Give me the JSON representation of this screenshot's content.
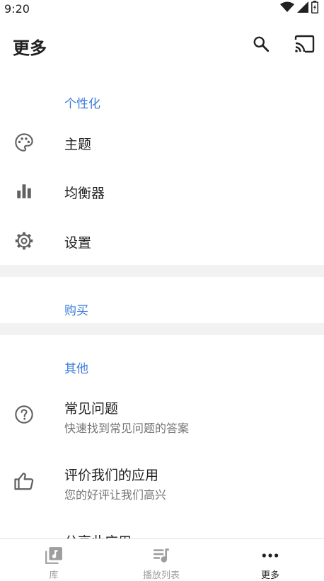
{
  "status_bar": {
    "time": "9:20",
    "icons": [
      "wifi-icon",
      "signal-icon",
      "battery-icon"
    ]
  },
  "app_bar": {
    "title": "更多",
    "actions": [
      "search-icon",
      "cast-icon"
    ]
  },
  "sections": {
    "personalize": {
      "header": "个性化",
      "items": [
        {
          "label": "主题",
          "icon": "palette-icon"
        },
        {
          "label": "均衡器",
          "icon": "equalizer-icon"
        },
        {
          "label": "设置",
          "icon": "gear-icon"
        }
      ]
    },
    "purchase": {
      "header": "购买"
    },
    "other": {
      "header": "其他",
      "items": [
        {
          "label": "常见问题",
          "subtitle": "快速找到常见问题的答案",
          "icon": "help-circle-icon"
        },
        {
          "label": "评价我们的应用",
          "subtitle": "您的好评让我们高兴",
          "icon": "thumbs-up-icon"
        },
        {
          "label": "分享此应用"
        }
      ]
    }
  },
  "bottom_nav": {
    "items": [
      {
        "label": "库",
        "icon": "library-music-icon",
        "active": false
      },
      {
        "label": "播放列表",
        "icon": "playlist-icon",
        "active": false
      },
      {
        "label": "更多",
        "icon": "more-horiz-icon",
        "active": true
      }
    ]
  },
  "colors": {
    "accent": "#3b7bdc",
    "text_primary": "#212121",
    "text_secondary": "#757575",
    "nav_inactive": "#9e9e9e",
    "divider": "#f2f2f2"
  }
}
